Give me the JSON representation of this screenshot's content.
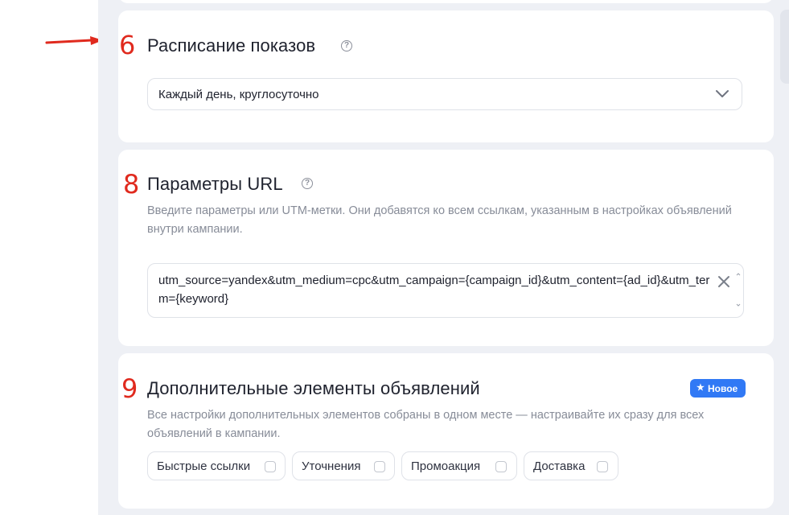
{
  "schedule": {
    "number": "6",
    "title": "Расписание показов",
    "help_icon": "question-circle-icon",
    "select_value": "Каждый день, круглосуточно"
  },
  "url_params": {
    "number": "8",
    "title": "Параметры URL",
    "help_icon": "question-circle-icon",
    "description": "Введите параметры или UTM-метки. Они добавятся ко всем ссылкам, указанным в настройках объявлений внутри кампании.",
    "value": "utm_source=yandex&utm_medium=cpc&utm_campaign={campaign_id}&utm_content={ad_id}&utm_term={keyword}"
  },
  "extensions": {
    "number": "9",
    "title": "Дополнительные элементы объявлений",
    "badge": "Новое",
    "badge_icon": "star-icon",
    "description": "Все настройки дополнительных элементов собраны в одном месте — настраивайте их сразу для всех объявлений в кампании.",
    "options": [
      {
        "label": "Быстрые ссылки",
        "checked": false
      },
      {
        "label": "Уточнения",
        "checked": false
      },
      {
        "label": "Промоакция",
        "checked": false
      },
      {
        "label": "Доставка",
        "checked": false
      }
    ]
  },
  "colors": {
    "accent_red": "#e02a1e",
    "badge_blue": "#3179f5",
    "page_bg": "#eef0f5"
  }
}
